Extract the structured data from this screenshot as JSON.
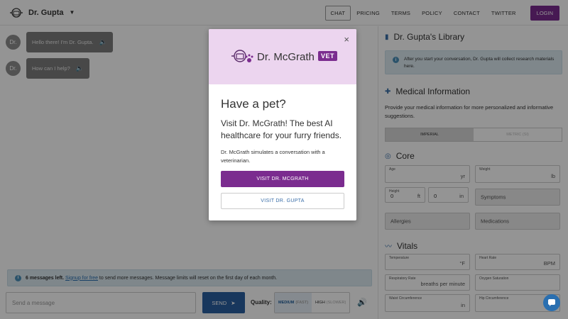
{
  "header": {
    "brand": "Dr. Gupta",
    "nav": [
      "CHAT",
      "PRICING",
      "TERMS",
      "POLICY",
      "CONTACT",
      "TWITTER"
    ],
    "login": "LOGIN"
  },
  "chat": {
    "avatar_label": "Dr.",
    "messages": [
      "Hello there! I'm Dr. Gupta.",
      "How can I help?"
    ],
    "limit_count": "6 messages left.",
    "limit_link": "Signup for free",
    "limit_rest": "to send more messages. Message limits will reset on the first day of each month.",
    "input_placeholder": "Send a message",
    "send_label": "SEND",
    "quality_label": "Quality:",
    "quality_options": [
      {
        "label": "MEDIUM",
        "sub": "(FAST)"
      },
      {
        "label": "HIGH",
        "sub": "(SLOWER)"
      }
    ]
  },
  "panel": {
    "library_title": "Dr. Gupta's Library",
    "library_note": "After you start your conversation, Dr. Gupta will collect research materials here.",
    "medical_title": "Medical Information",
    "medical_desc": "Provide your medical information for more personalized and informative suggestions.",
    "unit_tabs": [
      "IMPERIAL",
      "METRIC (SI)"
    ],
    "core_title": "Core",
    "age_label": "Age",
    "age_unit": "yr",
    "weight_label": "Weight",
    "weight_unit": "lb",
    "height_label": "Height",
    "height_ft_value": "0",
    "height_ft_unit": "ft",
    "height_in_value": "0",
    "height_in_unit": "in",
    "symptoms": "Symptoms",
    "allergies": "Allergies",
    "medications": "Medications",
    "vitals_title": "Vitals",
    "temperature_label": "Temperature",
    "temperature_unit": "°F",
    "heart_rate_label": "Heart Rate",
    "heart_rate_unit": "BPM",
    "resp_rate_label": "Respiratory Rate",
    "resp_rate_unit": "breaths per minute",
    "oxygen_label": "Oxygen Saturation",
    "waist_label": "Waist Circumference",
    "waist_unit": "in",
    "hip_label": "Hip Circumference"
  },
  "modal": {
    "brand": "Dr. McGrath",
    "badge": "VET",
    "title": "Have a pet?",
    "lead": "Visit Dr. McGrath! The best AI healthcare for your furry friends.",
    "desc": "Dr. McGrath simulates a conversation with a veterinarian.",
    "primary_btn": "VISIT DR. MCGRATH",
    "secondary_btn": "VISIT DR. GUPTA",
    "close": "×"
  },
  "colors": {
    "accent_purple": "#7b2c8f",
    "accent_blue": "#2a5fa0",
    "modal_header": "#ecd5ef"
  }
}
